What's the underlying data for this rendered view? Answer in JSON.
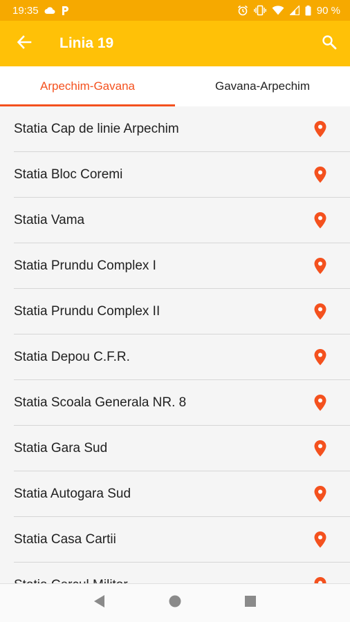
{
  "status_bar": {
    "time": "19:35",
    "battery": "90 %",
    "icons": [
      "cloud-icon",
      "parking-icon",
      "alarm-icon",
      "vibrate-icon",
      "wifi-icon",
      "signal-icon",
      "battery-icon"
    ]
  },
  "app_bar": {
    "title": "Linia 19",
    "back_icon": "arrow-left-icon",
    "search_icon": "search-icon",
    "color": "#ffc107"
  },
  "tabs": [
    {
      "label": "Arpechim-Gavana",
      "active": true
    },
    {
      "label": "Gavana-Arpechim",
      "active": false
    }
  ],
  "accent_color": "#f4511e",
  "stations": [
    {
      "name": "Statia Cap de linie Arpechim"
    },
    {
      "name": "Statia Bloc Coremi"
    },
    {
      "name": "Statia Vama"
    },
    {
      "name": "Statia Prundu Complex I"
    },
    {
      "name": "Statia Prundu Complex II"
    },
    {
      "name": "Statia Depou C.F.R."
    },
    {
      "name": "Statia Scoala Generala NR. 8"
    },
    {
      "name": "Statia Gara Sud"
    },
    {
      "name": "Statia Autogara Sud"
    },
    {
      "name": "Statia Casa Cartii"
    },
    {
      "name": "Statia Cercul Militar"
    }
  ],
  "nav_bar": {
    "icons": [
      "back-triangle-icon",
      "home-circle-icon",
      "recents-square-icon"
    ]
  }
}
